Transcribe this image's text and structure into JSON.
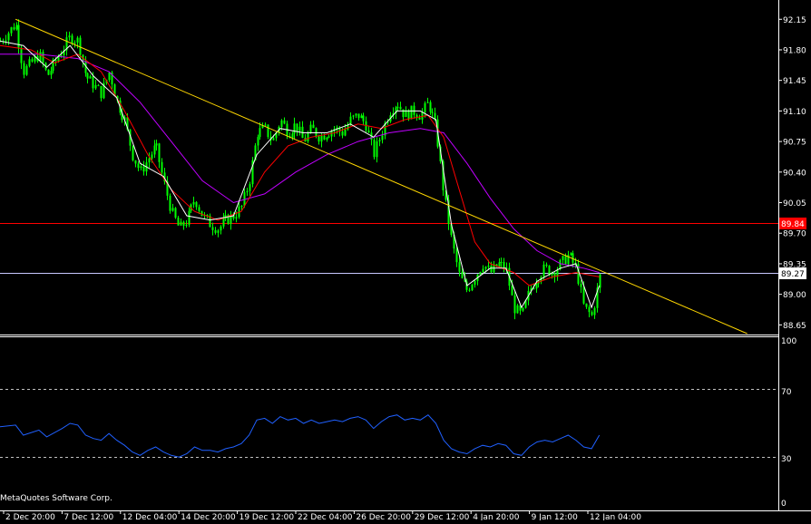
{
  "copyright": "MetaQuotes Software Corp.",
  "colors": {
    "background": "#000000",
    "frame": "#ffffff",
    "candle": "#00ff00",
    "ma_fast": "#ffffff",
    "ma_mid": "#ff0000",
    "ma_slow": "#c000ff",
    "trendline": "#ffd700",
    "level_line": "#ff0000",
    "bid_line": "#c8c8ff",
    "rsi": "#2060ff",
    "rsi_levels": "#c0c0c0"
  },
  "price_axis": {
    "ticks": [
      "92.15",
      "91.80",
      "91.45",
      "91.10",
      "90.75",
      "90.40",
      "90.05",
      "89.70",
      "89.35",
      "89.00",
      "88.65"
    ],
    "level_label": "89.84",
    "current_label": "89.27"
  },
  "rsi_axis": {
    "ticks": [
      "100",
      "70",
      "30",
      "0"
    ]
  },
  "time_axis": {
    "ticks": [
      "2 Dec 20:00",
      "7 Dec 12:00",
      "12 Dec 04:00",
      "14 Dec 20:00",
      "19 Dec 12:00",
      "22 Dec 04:00",
      "26 Dec 20:00",
      "29 Dec 12:00",
      "4 Jan 20:00",
      "9 Jan 12:00",
      "12 Jan 04:00"
    ]
  },
  "chart_data": {
    "type": "candlestick",
    "price_range": [
      88.55,
      92.35
    ],
    "level": 89.84,
    "current": 89.27,
    "trendline": [
      [
        0.02,
        92.15
      ],
      [
        0.96,
        88.55
      ]
    ],
    "price_path": [
      [
        0.0,
        91.9
      ],
      [
        0.02,
        92.1
      ],
      [
        0.03,
        91.55
      ],
      [
        0.05,
        91.75
      ],
      [
        0.06,
        91.5
      ],
      [
        0.08,
        91.8
      ],
      [
        0.09,
        91.95
      ],
      [
        0.1,
        91.9
      ],
      [
        0.11,
        91.5
      ],
      [
        0.12,
        91.4
      ],
      [
        0.13,
        91.3
      ],
      [
        0.14,
        91.55
      ],
      [
        0.15,
        91.2
      ],
      [
        0.16,
        91.0
      ],
      [
        0.17,
        90.6
      ],
      [
        0.18,
        90.4
      ],
      [
        0.19,
        90.55
      ],
      [
        0.2,
        90.7
      ],
      [
        0.21,
        90.3
      ],
      [
        0.22,
        89.95
      ],
      [
        0.23,
        89.75
      ],
      [
        0.24,
        89.85
      ],
      [
        0.25,
        90.1
      ],
      [
        0.26,
        89.9
      ],
      [
        0.27,
        89.8
      ],
      [
        0.28,
        89.75
      ],
      [
        0.29,
        89.85
      ],
      [
        0.3,
        89.9
      ],
      [
        0.31,
        90.0
      ],
      [
        0.32,
        90.3
      ],
      [
        0.33,
        90.85
      ],
      [
        0.34,
        90.9
      ],
      [
        0.35,
        90.75
      ],
      [
        0.36,
        91.0
      ],
      [
        0.37,
        90.85
      ],
      [
        0.38,
        90.95
      ],
      [
        0.39,
        90.75
      ],
      [
        0.4,
        90.9
      ],
      [
        0.41,
        90.8
      ],
      [
        0.42,
        90.85
      ],
      [
        0.43,
        90.9
      ],
      [
        0.44,
        90.85
      ],
      [
        0.45,
        91.0
      ],
      [
        0.46,
        91.05
      ],
      [
        0.47,
        90.95
      ],
      [
        0.48,
        90.6
      ],
      [
        0.49,
        90.85
      ],
      [
        0.5,
        91.1
      ],
      [
        0.51,
        91.2
      ],
      [
        0.52,
        91.05
      ],
      [
        0.53,
        91.1
      ],
      [
        0.54,
        91.05
      ],
      [
        0.55,
        91.2
      ],
      [
        0.56,
        90.9
      ],
      [
        0.57,
        90.15
      ],
      [
        0.58,
        89.6
      ],
      [
        0.59,
        89.2
      ],
      [
        0.6,
        89.05
      ],
      [
        0.61,
        89.2
      ],
      [
        0.62,
        89.35
      ],
      [
        0.63,
        89.25
      ],
      [
        0.64,
        89.35
      ],
      [
        0.65,
        89.3
      ],
      [
        0.66,
        88.85
      ],
      [
        0.67,
        88.75
      ],
      [
        0.68,
        89.05
      ],
      [
        0.69,
        89.2
      ],
      [
        0.7,
        89.3
      ],
      [
        0.71,
        89.25
      ],
      [
        0.72,
        89.35
      ],
      [
        0.73,
        89.45
      ],
      [
        0.74,
        89.3
      ],
      [
        0.75,
        88.85
      ],
      [
        0.76,
        88.75
      ],
      [
        0.77,
        89.2
      ]
    ],
    "ma_fast": [
      [
        0.0,
        91.9
      ],
      [
        0.03,
        91.85
      ],
      [
        0.06,
        91.6
      ],
      [
        0.09,
        91.85
      ],
      [
        0.12,
        91.5
      ],
      [
        0.15,
        91.25
      ],
      [
        0.18,
        90.5
      ],
      [
        0.21,
        90.35
      ],
      [
        0.24,
        89.9
      ],
      [
        0.27,
        89.85
      ],
      [
        0.3,
        89.9
      ],
      [
        0.33,
        90.6
      ],
      [
        0.36,
        90.9
      ],
      [
        0.39,
        90.85
      ],
      [
        0.42,
        90.85
      ],
      [
        0.45,
        90.95
      ],
      [
        0.48,
        90.8
      ],
      [
        0.51,
        91.1
      ],
      [
        0.54,
        91.1
      ],
      [
        0.56,
        91.0
      ],
      [
        0.58,
        89.8
      ],
      [
        0.6,
        89.1
      ],
      [
        0.63,
        89.3
      ],
      [
        0.65,
        89.3
      ],
      [
        0.67,
        88.85
      ],
      [
        0.69,
        89.15
      ],
      [
        0.72,
        89.3
      ],
      [
        0.74,
        89.35
      ],
      [
        0.76,
        88.85
      ],
      [
        0.77,
        89.1
      ]
    ],
    "ma_mid": [
      [
        0.0,
        91.85
      ],
      [
        0.04,
        91.8
      ],
      [
        0.07,
        91.65
      ],
      [
        0.1,
        91.75
      ],
      [
        0.13,
        91.55
      ],
      [
        0.16,
        91.1
      ],
      [
        0.19,
        90.6
      ],
      [
        0.22,
        90.2
      ],
      [
        0.25,
        89.95
      ],
      [
        0.28,
        89.85
      ],
      [
        0.31,
        89.95
      ],
      [
        0.34,
        90.4
      ],
      [
        0.37,
        90.7
      ],
      [
        0.4,
        90.8
      ],
      [
        0.43,
        90.85
      ],
      [
        0.46,
        90.95
      ],
      [
        0.49,
        90.9
      ],
      [
        0.52,
        91.0
      ],
      [
        0.55,
        91.05
      ],
      [
        0.57,
        90.8
      ],
      [
        0.59,
        90.2
      ],
      [
        0.61,
        89.6
      ],
      [
        0.63,
        89.35
      ],
      [
        0.66,
        89.25
      ],
      [
        0.68,
        89.1
      ],
      [
        0.71,
        89.2
      ],
      [
        0.74,
        89.25
      ],
      [
        0.77,
        89.2
      ]
    ],
    "ma_slow": [
      [
        0.0,
        91.75
      ],
      [
        0.05,
        91.75
      ],
      [
        0.1,
        91.7
      ],
      [
        0.14,
        91.55
      ],
      [
        0.18,
        91.2
      ],
      [
        0.22,
        90.75
      ],
      [
        0.26,
        90.3
      ],
      [
        0.3,
        90.05
      ],
      [
        0.34,
        90.15
      ],
      [
        0.38,
        90.4
      ],
      [
        0.42,
        90.6
      ],
      [
        0.46,
        90.75
      ],
      [
        0.5,
        90.85
      ],
      [
        0.54,
        90.9
      ],
      [
        0.57,
        90.85
      ],
      [
        0.6,
        90.5
      ],
      [
        0.63,
        90.1
      ],
      [
        0.66,
        89.75
      ],
      [
        0.69,
        89.5
      ],
      [
        0.72,
        89.35
      ],
      [
        0.75,
        89.3
      ],
      [
        0.77,
        89.25
      ]
    ],
    "rsi_range": [
      0,
      100
    ],
    "rsi_levels": [
      70,
      30
    ],
    "rsi": [
      [
        0.0,
        48
      ],
      [
        0.02,
        49
      ],
      [
        0.03,
        43
      ],
      [
        0.05,
        46
      ],
      [
        0.06,
        42
      ],
      [
        0.08,
        47
      ],
      [
        0.09,
        50
      ],
      [
        0.1,
        49
      ],
      [
        0.11,
        43
      ],
      [
        0.12,
        41
      ],
      [
        0.13,
        40
      ],
      [
        0.14,
        44
      ],
      [
        0.15,
        40
      ],
      [
        0.16,
        37
      ],
      [
        0.17,
        33
      ],
      [
        0.18,
        31
      ],
      [
        0.19,
        34
      ],
      [
        0.2,
        36
      ],
      [
        0.21,
        33
      ],
      [
        0.22,
        31
      ],
      [
        0.23,
        30
      ],
      [
        0.24,
        32
      ],
      [
        0.25,
        36
      ],
      [
        0.26,
        34
      ],
      [
        0.27,
        34
      ],
      [
        0.28,
        33
      ],
      [
        0.29,
        35
      ],
      [
        0.3,
        36
      ],
      [
        0.31,
        38
      ],
      [
        0.32,
        43
      ],
      [
        0.33,
        52
      ],
      [
        0.34,
        53
      ],
      [
        0.35,
        50
      ],
      [
        0.36,
        54
      ],
      [
        0.37,
        52
      ],
      [
        0.38,
        53
      ],
      [
        0.39,
        50
      ],
      [
        0.4,
        52
      ],
      [
        0.41,
        50
      ],
      [
        0.42,
        51
      ],
      [
        0.43,
        52
      ],
      [
        0.44,
        51
      ],
      [
        0.45,
        53
      ],
      [
        0.46,
        54
      ],
      [
        0.47,
        52
      ],
      [
        0.48,
        47
      ],
      [
        0.49,
        51
      ],
      [
        0.5,
        54
      ],
      [
        0.51,
        55
      ],
      [
        0.52,
        52
      ],
      [
        0.53,
        53
      ],
      [
        0.54,
        52
      ],
      [
        0.55,
        55
      ],
      [
        0.56,
        50
      ],
      [
        0.57,
        40
      ],
      [
        0.58,
        35
      ],
      [
        0.59,
        33
      ],
      [
        0.6,
        32
      ],
      [
        0.61,
        35
      ],
      [
        0.62,
        37
      ],
      [
        0.63,
        36
      ],
      [
        0.64,
        38
      ],
      [
        0.65,
        37
      ],
      [
        0.66,
        32
      ],
      [
        0.67,
        31
      ],
      [
        0.68,
        36
      ],
      [
        0.69,
        39
      ],
      [
        0.7,
        40
      ],
      [
        0.71,
        39
      ],
      [
        0.72,
        41
      ],
      [
        0.73,
        43
      ],
      [
        0.74,
        40
      ],
      [
        0.75,
        36
      ],
      [
        0.76,
        35
      ],
      [
        0.77,
        43
      ]
    ]
  }
}
